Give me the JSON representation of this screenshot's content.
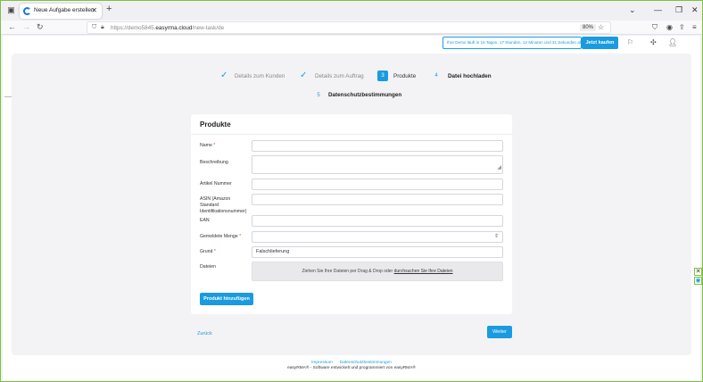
{
  "browser": {
    "tab_title": "Neue Aufgabe erstellen",
    "url_prefix": "https://demo5845.",
    "url_domain": "easyrma.cloud",
    "url_path": "/new-task/de",
    "zoom": "80%"
  },
  "app": {
    "trial_text": "Ihre Demo läuft in 16 Tagen, 17 Stunden, 12 Minuten und 31 Sekunden ab",
    "buy_label": "Jetzt kaufen"
  },
  "steps": [
    {
      "label": "Details zum Kunden",
      "marker": "✓"
    },
    {
      "label": "Details zum Auftrag",
      "marker": "✓"
    },
    {
      "label": "Produkte",
      "marker": "3"
    },
    {
      "label": "Datei hochladen",
      "marker": "4"
    },
    {
      "label": "Datenschutzbestimmungen",
      "marker": "5"
    }
  ],
  "form": {
    "title": "Produkte",
    "fields": {
      "name": {
        "label": "Name",
        "required": "*"
      },
      "description": {
        "label": "Beschreibung"
      },
      "article_no": {
        "label": "Artikel Nummer"
      },
      "asin": {
        "label": "ASIN (Amazon Standard Identifikationsnummer)"
      },
      "ean": {
        "label": "EAN"
      },
      "quantity": {
        "label": "Gemeldete Menge",
        "required": "*"
      },
      "reason": {
        "label": "Grund",
        "required": "*",
        "value": "Falschlieferung"
      },
      "files": {
        "label": "Dateien",
        "drop_text": "Ziehen Sie Ihre Dateien per Drag & Drop oder",
        "drop_link": "durchsuchen Sie Ihre Dateien"
      }
    },
    "add_button": "Produkt hinzufügen"
  },
  "nav": {
    "back": "Zurück",
    "next": "Weiter"
  },
  "footer": {
    "imprint": "Impressum",
    "privacy": "Datenschutzbestimmungen",
    "credit": "easyRMA® - Software entwickelt und programmiert von easyRMA®"
  }
}
